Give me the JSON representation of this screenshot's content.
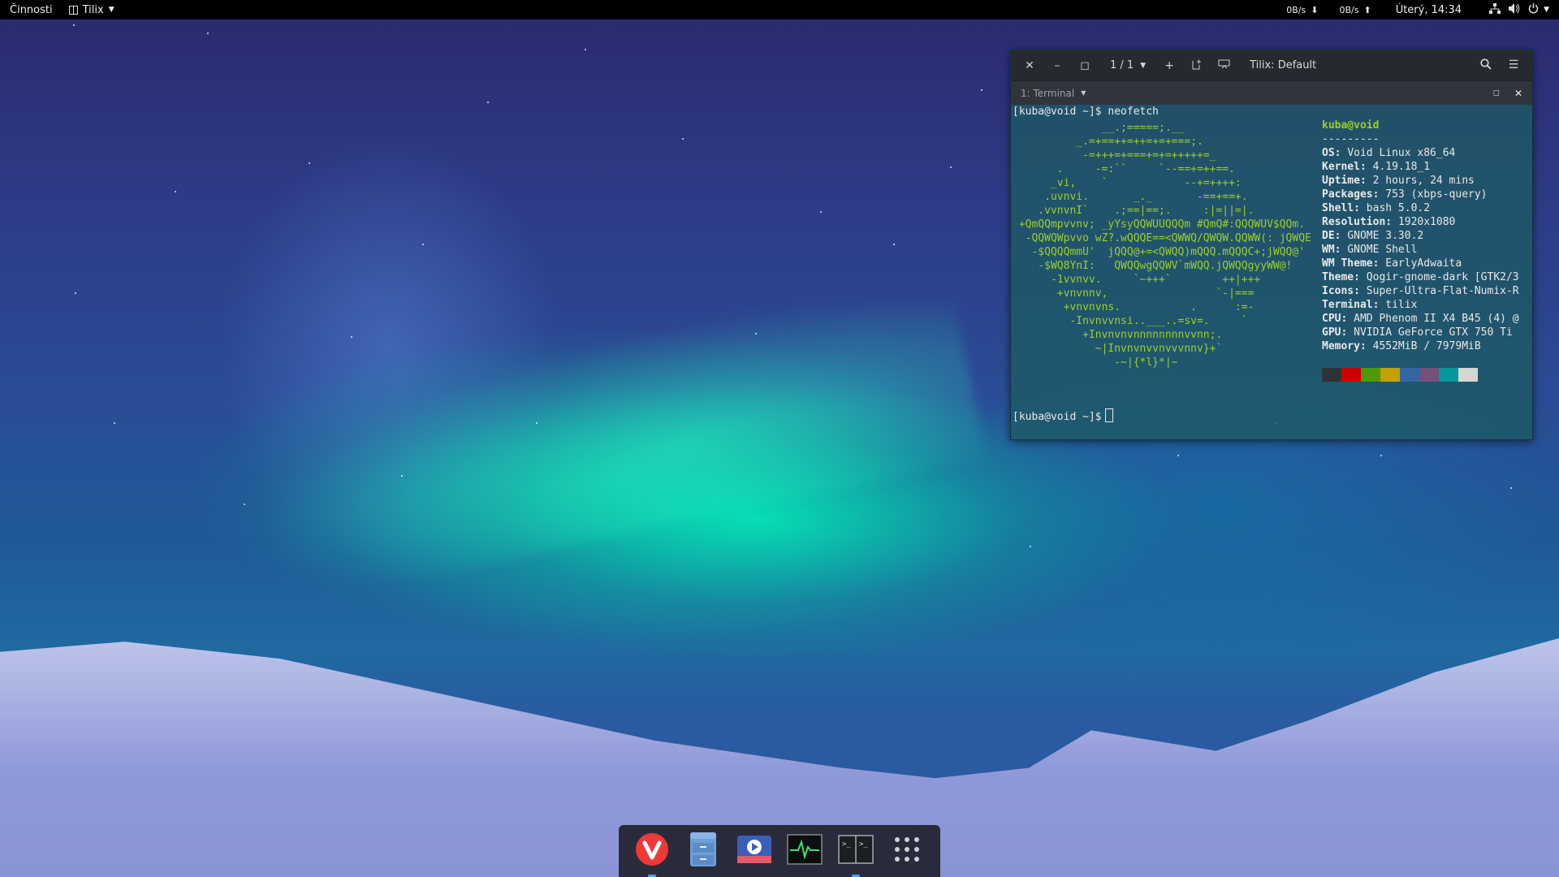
{
  "top_bar": {
    "activities": "Činnosti",
    "app_menu": "Tilix",
    "net_down": "0B/s",
    "net_up": "0B/s",
    "clock": "Úterý, 14:34"
  },
  "terminal": {
    "session_indicator": "1 / 1",
    "title": "Tilix: Default",
    "tab_label": "1: Terminal",
    "prompt_line": "[kuba@void ~]$ neofetch",
    "prompt_end": "[kuba@void ~]$",
    "logo_art": "              __.;=====;.__\n          _.=+==++=++=+=+===;.\n           -=+++=+===+=+=+++++=_\n       .     -=:``     `--==+=++==.\n      _vi,    `            --+=++++:\n     .uvnvi.       _._       -==+==+.\n    .vvnvnI`    .;==|==;.     :|=||=|.\n +QmQQmpvvnv; _yYsyQQWUUQQQm #QmQ#:QQQWUV$QQm.\n  -QQWQWpvvo wZ?.wQQQE==<QWWQ/QWQW.QQWW(: jQWQE\n   -$QQQQmmU'  jQQQ@+=<QWQQ)mQQQ.mQQQC+;jWQQ@'\n    -$WQ8YnI:   QWQQwgQQWV`mWQQ.jQWQQgyyWW@!\n      -1vvnvv.     `~+++`        ++|+++\n       +vnvnnv,                 `-|===\n        +vnvnvns.           .      :=-\n         -Invnvvnsi..___..=sv=.     `\n           +Invnvnvnnnnnnnnvvnn;.\n             ~|Invnvnvvnvvvnnv}+`\n                -~|{*l}*|~",
    "user_host": "kuba@void",
    "separator": "---------",
    "info": [
      {
        "key": "OS",
        "value": "Void Linux x86_64"
      },
      {
        "key": "Kernel",
        "value": "4.19.18_1"
      },
      {
        "key": "Uptime",
        "value": "2 hours, 24 mins"
      },
      {
        "key": "Packages",
        "value": "753 (xbps-query)"
      },
      {
        "key": "Shell",
        "value": "bash 5.0.2"
      },
      {
        "key": "Resolution",
        "value": "1920x1080"
      },
      {
        "key": "DE",
        "value": "GNOME 3.30.2"
      },
      {
        "key": "WM",
        "value": "GNOME Shell"
      },
      {
        "key": "WM Theme",
        "value": "EarlyAdwaita"
      },
      {
        "key": "Theme",
        "value": "Qogir-gnome-dark [GTK2/3"
      },
      {
        "key": "Icons",
        "value": "Super-Ultra-Flat-Numix-R"
      },
      {
        "key": "Terminal",
        "value": "tilix"
      },
      {
        "key": "CPU",
        "value": "AMD Phenom II X4 B45 (4) @"
      },
      {
        "key": "GPU",
        "value": "NVIDIA GeForce GTX 750 Ti"
      },
      {
        "key": "Memory",
        "value": "4552MiB / 7979MiB"
      }
    ],
    "palette": [
      "#2e3436",
      "#cc0000",
      "#4e9a06",
      "#c4a000",
      "#3465a4",
      "#75507b",
      "#06989a",
      "#d3d7cf"
    ]
  },
  "dock": {
    "items": [
      {
        "name": "vivaldi-icon",
        "running": true
      },
      {
        "name": "file-cabinet-icon",
        "running": false
      },
      {
        "name": "video-player-icon",
        "running": false
      },
      {
        "name": "system-monitor-icon",
        "running": false
      },
      {
        "name": "tilix-icon",
        "running": true
      },
      {
        "name": "app-grid-icon",
        "running": false
      }
    ]
  }
}
